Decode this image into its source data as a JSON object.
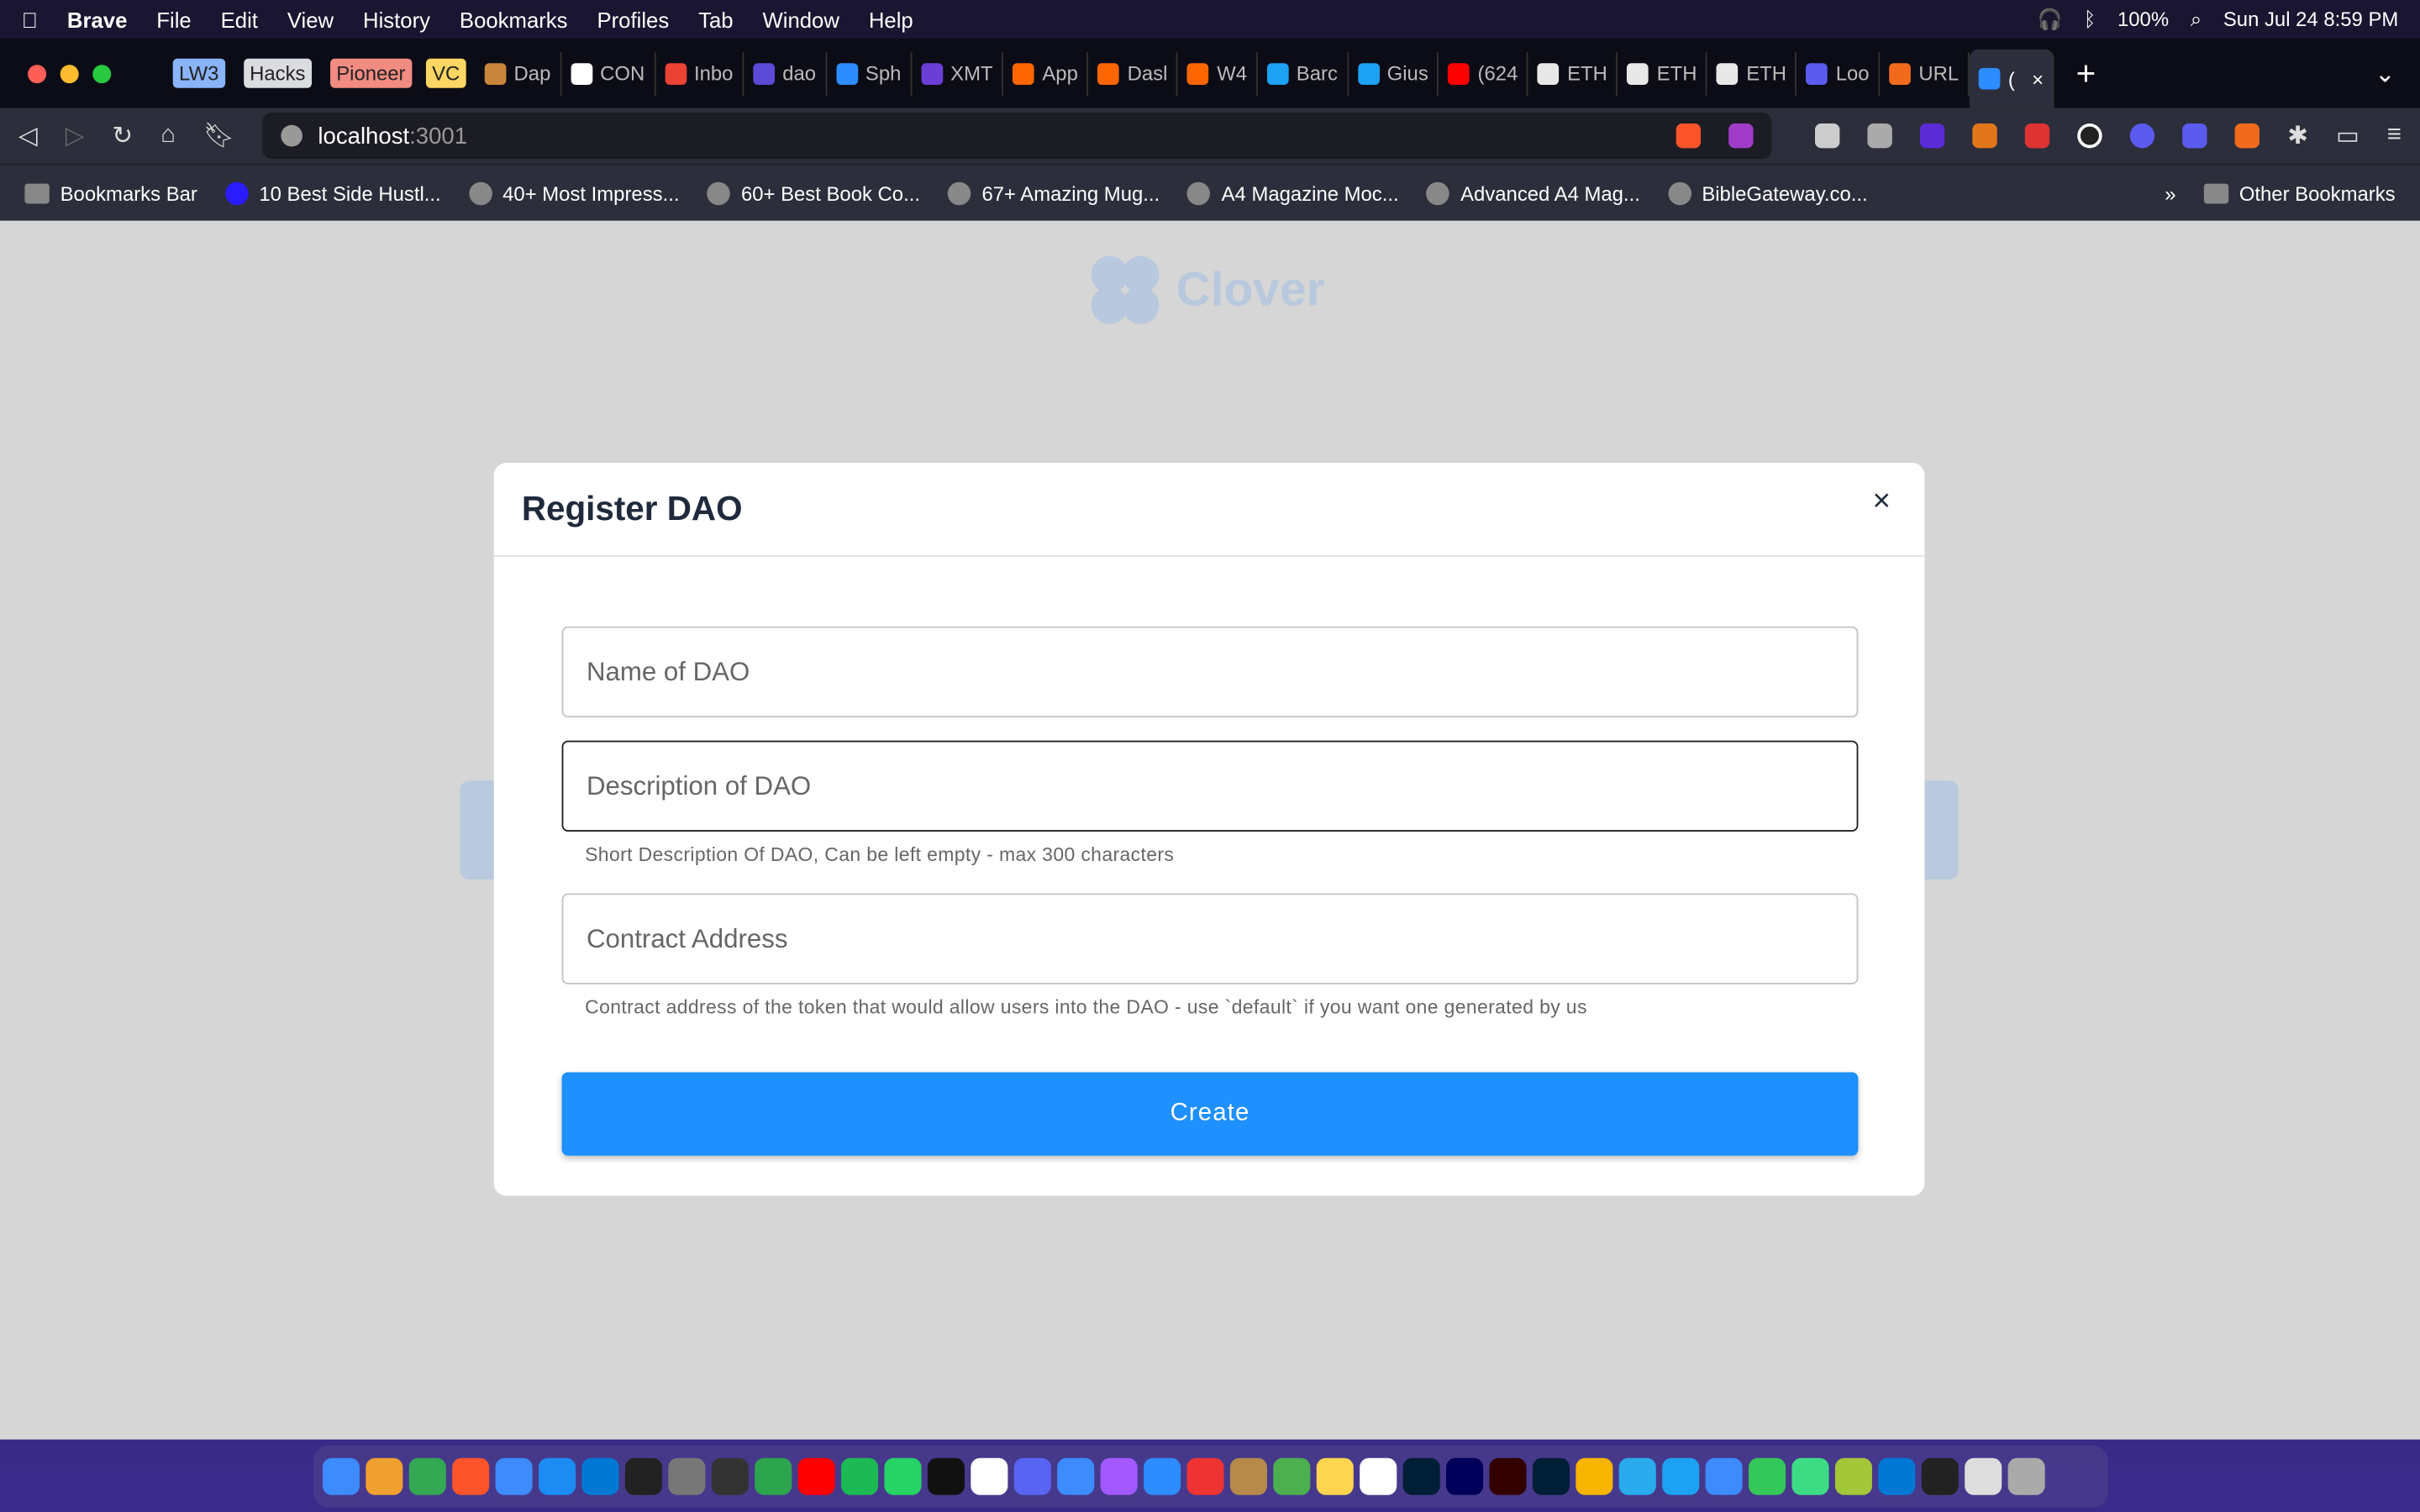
{
  "menubar": {
    "app": "Brave",
    "items": [
      "File",
      "Edit",
      "View",
      "History",
      "Bookmarks",
      "Profiles",
      "Tab",
      "Window",
      "Help"
    ],
    "battery": "100%",
    "datetime": "Sun Jul 24  8:59 PM"
  },
  "tabs": [
    {
      "label": "LW3",
      "type": "pill",
      "color": "#8ab4f8"
    },
    {
      "label": "Hacks",
      "type": "pill",
      "color": "#dadce0"
    },
    {
      "label": "Pioneer",
      "type": "pill",
      "color": "#f28b82"
    },
    {
      "label": "VC",
      "type": "pill",
      "color": "#fdd663"
    },
    {
      "label": "Dap",
      "color": "#c9853b"
    },
    {
      "label": "CON",
      "color": "#ffffff"
    },
    {
      "label": "Inbo",
      "color": "#ea4335"
    },
    {
      "label": "dao",
      "color": "#5b4bd6"
    },
    {
      "label": "Sph",
      "color": "#2d8cff"
    },
    {
      "label": "XMT",
      "color": "#6b3fd6"
    },
    {
      "label": "App",
      "color": "#ff6600"
    },
    {
      "label": "Dasl",
      "color": "#ff6600"
    },
    {
      "label": "W4",
      "color": "#ff6600"
    },
    {
      "label": "Barc",
      "color": "#1da1f2"
    },
    {
      "label": "Gius",
      "color": "#1da1f2"
    },
    {
      "label": "(624",
      "color": "#ff0000"
    },
    {
      "label": "ETH",
      "color": "#e8e8e8"
    },
    {
      "label": "ETH",
      "color": "#e8e8e8"
    },
    {
      "label": "ETH",
      "color": "#e8e8e8"
    },
    {
      "label": "Loo",
      "color": "#5b5bf0"
    },
    {
      "label": "URL",
      "color": "#f26b1d"
    },
    {
      "label": "(",
      "color": "#2d8cff",
      "active": true
    }
  ],
  "toolbar": {
    "url_host": "localhost",
    "url_port": ":3001"
  },
  "bookmarks": {
    "items": [
      "Bookmarks Bar",
      "10 Best Side Hustl...",
      "40+ Most Impress...",
      "60+ Best Book Co...",
      "67+ Amazing Mug...",
      "A4 Magazine Moc...",
      "Advanced A4 Mag...",
      "BibleGateway.co..."
    ],
    "more": "»",
    "other": "Other Bookmarks"
  },
  "page": {
    "logo_text": "Clover",
    "accent": "#1e90ff"
  },
  "modal": {
    "title": "Register DAO",
    "close": "×",
    "name_placeholder": "Name of DAO",
    "description_placeholder": "Description of DAO",
    "description_help": "Short Description Of DAO, Can be left empty - max 300 characters",
    "contract_placeholder": "Contract Address",
    "contract_help": "Contract address of the token that would allow users into the DAO - use `default` if you want one generated by us",
    "create_label": "Create"
  },
  "dock": {
    "colors": [
      "#3d8bfd",
      "#f0a030",
      "#34a853",
      "#fb542b",
      "#3d8bfd",
      "#1c8cf2",
      "#0078d4",
      "#222",
      "#777",
      "#333",
      "#2da44e",
      "#ff0000",
      "#1db954",
      "#25d366",
      "#111",
      "#fff",
      "#5865f2",
      "#3d8bfd",
      "#a259ff",
      "#2d8cff",
      "#e33",
      "#b58a4a",
      "#4caf50",
      "#ffd54f",
      "#fff",
      "#001e36",
      "#00005b",
      "#330000",
      "#001e36",
      "#f7b500",
      "#2aabee",
      "#1da1f2",
      "#3d8bfd",
      "#34c759",
      "#3ddc84",
      "#a4c639",
      "#0078d4",
      "#222",
      "#ddd",
      "#aaa"
    ]
  }
}
